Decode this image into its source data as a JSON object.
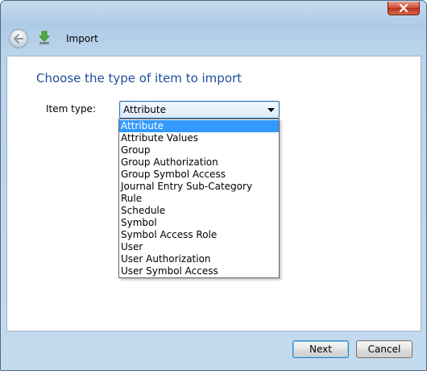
{
  "window": {
    "title": "Import",
    "close_icon": "close-icon",
    "back_icon": "back-arrow-icon",
    "app_icon": "import-icon"
  },
  "main": {
    "heading": "Choose the type of item to import",
    "item_type_label": "Item type:",
    "item_type_value": "Attribute",
    "item_type_options": [
      "Attribute",
      "Attribute Values",
      "Group",
      "Group Authorization",
      "Group Symbol Access",
      "Journal Entry Sub-Category",
      "Rule",
      "Schedule",
      "Symbol",
      "Symbol Access Role",
      "User",
      "User Authorization",
      "User Symbol Access"
    ],
    "selected_index": 0
  },
  "footer": {
    "next_label": "Next",
    "cancel_label": "Cancel"
  },
  "colors": {
    "heading": "#1e4e9a",
    "selection": "#3399ff"
  }
}
